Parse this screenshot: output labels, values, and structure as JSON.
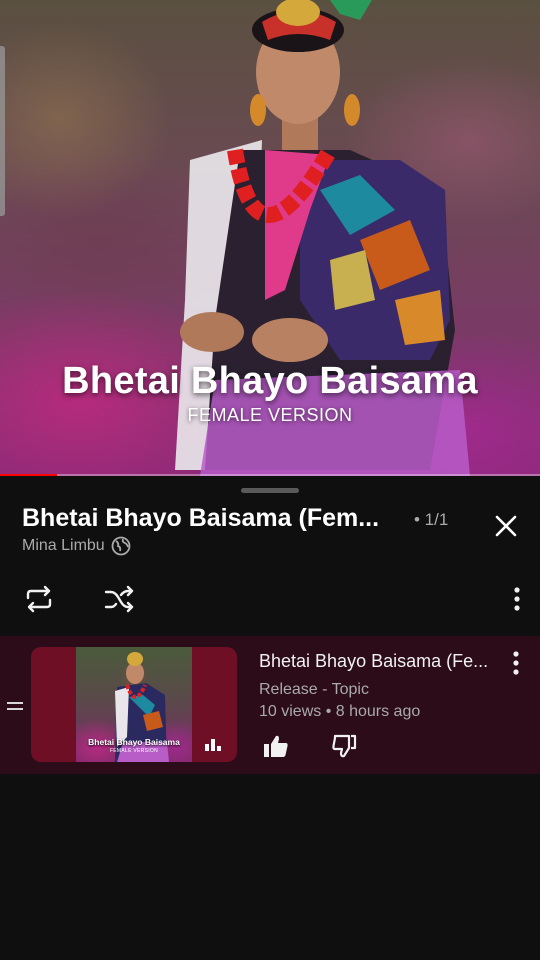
{
  "video": {
    "overlay_title": "Bhetai Bhayo Baisama",
    "overlay_subtitle": "FEMALE VERSION",
    "progress_fraction": 0.105
  },
  "queue": {
    "playlist_title": "Bhetai Bhayo Baisama (Fem...",
    "position": "• 1/1",
    "owner": "Mina Limbu",
    "icons": [
      "globe-icon",
      "close-icon",
      "repeat-icon",
      "shuffle-icon",
      "more-vert-icon"
    ],
    "items": [
      {
        "title": "Bhetai Bhayo Baisama (Fe...",
        "channel": "Release - Topic",
        "meta": "10 views • 8 hours ago",
        "thumb_title": "Bhetai Bhayo Baisama",
        "thumb_subtitle": "FEMALE VERSION",
        "now_playing": true
      }
    ]
  },
  "colors": {
    "background": "#0f0f0f",
    "active_row": "#2b0c18",
    "progress": "#ff0000",
    "secondary_text": "#aaaaaa"
  }
}
